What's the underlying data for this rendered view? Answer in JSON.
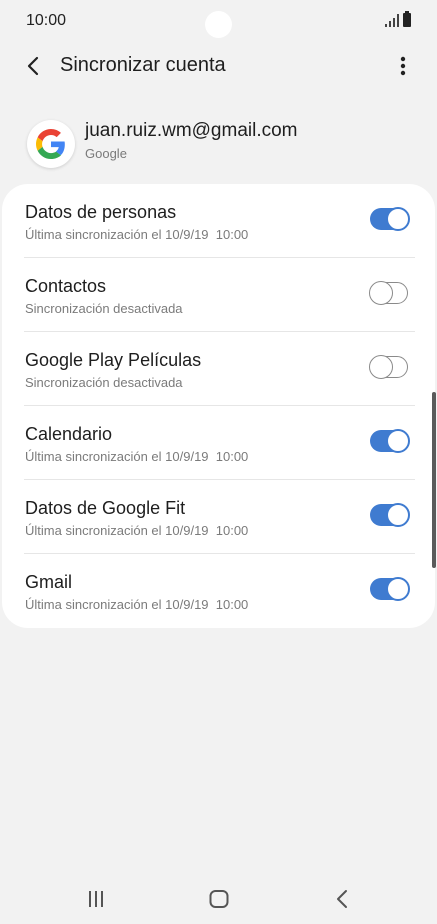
{
  "status_bar": {
    "time": "10:00"
  },
  "header": {
    "title": "Sincronizar cuenta"
  },
  "account": {
    "email": "juan.ruiz.wm@gmail.com",
    "provider": "Google"
  },
  "sync_items": [
    {
      "label": "Datos de personas",
      "status": "Última sincronización el 10/9/19  10:00",
      "enabled": true
    },
    {
      "label": "Contactos",
      "status": "Sincronización desactivada",
      "enabled": false
    },
    {
      "label": "Google Play Películas",
      "status": "Sincronización desactivada",
      "enabled": false
    },
    {
      "label": "Calendario",
      "status": "Última sincronización el 10/9/19  10:00",
      "enabled": true
    },
    {
      "label": "Datos de Google Fit",
      "status": "Última sincronización el 10/9/19  10:00",
      "enabled": true
    },
    {
      "label": "Gmail",
      "status": "Última sincronización el 10/9/19  10:00",
      "enabled": true
    }
  ],
  "colors": {
    "accent": "#3f7bd0",
    "background": "#f2f2f2",
    "card": "#ffffff"
  },
  "icons": {
    "back": "back-arrow-icon",
    "more": "more-vert-icon",
    "nav_recent": "recent-apps-icon",
    "nav_home": "home-icon",
    "nav_back": "nav-back-icon"
  }
}
